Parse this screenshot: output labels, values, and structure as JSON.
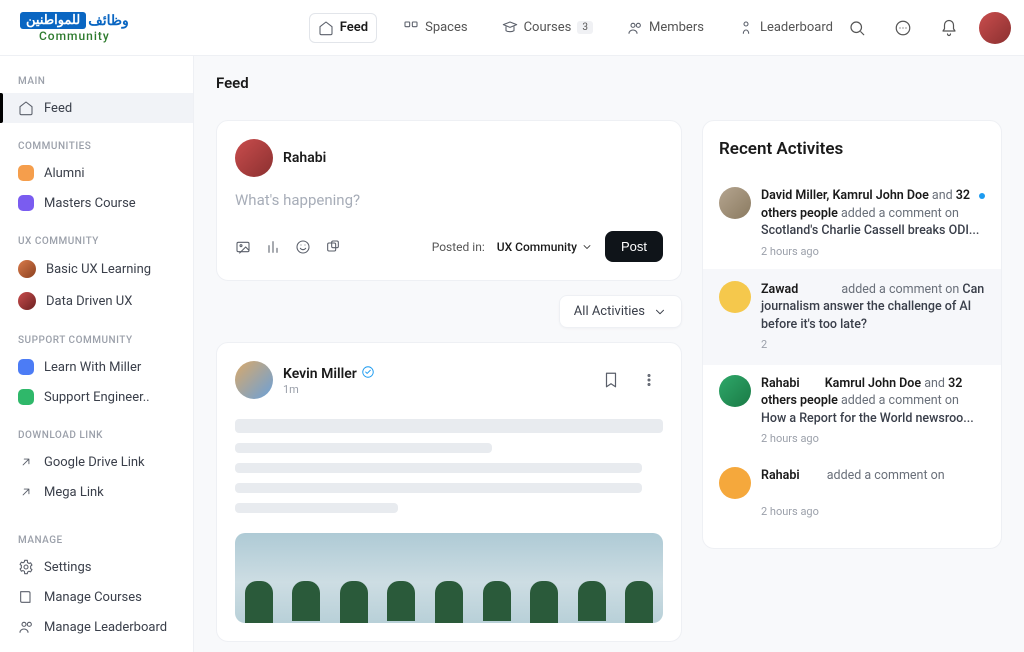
{
  "logo": {
    "arabic_box": "للمواطنين",
    "arabic_text": "وظائف",
    "community": "Community"
  },
  "nav": {
    "feed": "Feed",
    "spaces": "Spaces",
    "courses": "Courses",
    "courses_badge": "3",
    "members": "Members",
    "leaderboard": "Leaderboard"
  },
  "page_title": "Feed",
  "sidebar": {
    "sections": {
      "main": "MAIN",
      "communities": "COMMUNITIES",
      "ux": "UX COMMUNITY",
      "support": "SUPPORT COMMUNITY",
      "download": "DOWNLOAD LINK",
      "manage": "MANAGE"
    },
    "feed": "Feed",
    "alumni": "Alumni",
    "masters": "Masters Course",
    "basic_ux": "Basic UX Learning",
    "data_ux": "Data Driven UX",
    "learn_miller": "Learn With Miller",
    "support_eng": "Support Engineer..",
    "gdrive": "Google Drive Link",
    "mega": "Mega Link",
    "settings": "Settings",
    "manage_courses": "Manage Courses",
    "manage_leaderboard": "Manage Leaderboard"
  },
  "composer": {
    "name": "Rahabi",
    "placeholder": "What's happening?",
    "posted_in_label": "Posted in:",
    "posted_in_value": "UX Community",
    "post_btn": "Post"
  },
  "filter": {
    "label": "All Activities"
  },
  "post": {
    "author": "Kevin Miller",
    "time": "1m"
  },
  "activities": {
    "title": "Recent Activites",
    "items": [
      {
        "names": "David Miller, Kamrul John Doe",
        "connector": " and ",
        "count": "32 others people",
        "action": " added a comment on ",
        "target": "Scotland's Charlie Cassell breaks ODI...",
        "time": "2 hours ago",
        "unread": true
      },
      {
        "names": "Zawad",
        "connector": "",
        "count": "",
        "action": "added a comment on ",
        "target": "Can journalism answer the challenge of AI before it's too late?",
        "time": "2",
        "highlight": true
      },
      {
        "names": "Rahabi",
        "names2": "Kamrul John Doe",
        "connector": " and ",
        "count": "32 others people",
        "action": " added a comment on ",
        "target": "How a Report for the World newsroo...",
        "time": "2 hours ago"
      },
      {
        "names": "Rahabi",
        "connector": "",
        "count": "",
        "action": "added a comment on",
        "target": "",
        "time": "2 hours ago"
      }
    ]
  }
}
